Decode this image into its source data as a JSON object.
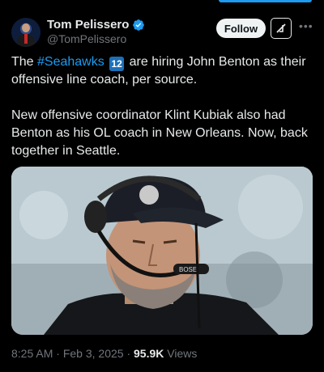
{
  "author": {
    "name": "Tom Pelissero",
    "handle": "@TomPelissero",
    "verified": true
  },
  "actions": {
    "follow_label": "Follow",
    "grok_icon": "grok-icon",
    "more_icon": "more-icon"
  },
  "tweet": {
    "p1_prefix": "The ",
    "hashtag": "#Seahawks",
    "emoji": "12",
    "p1_suffix": " are hiring John Benton as their offensive line coach, per source.",
    "p2": "New offensive coordinator Klint Kubiak also had Benton as his OL coach in New Orleans. Now, back together in Seattle."
  },
  "meta": {
    "time": "8:25 AM",
    "separator1": " · ",
    "date": "Feb 3, 2025",
    "separator2": " · ",
    "views_count": "95.9K",
    "views_label": " Views"
  },
  "colors": {
    "accent": "#1d9bf0",
    "text": "#e7e9ea",
    "muted": "#71767b",
    "background": "#000000"
  }
}
